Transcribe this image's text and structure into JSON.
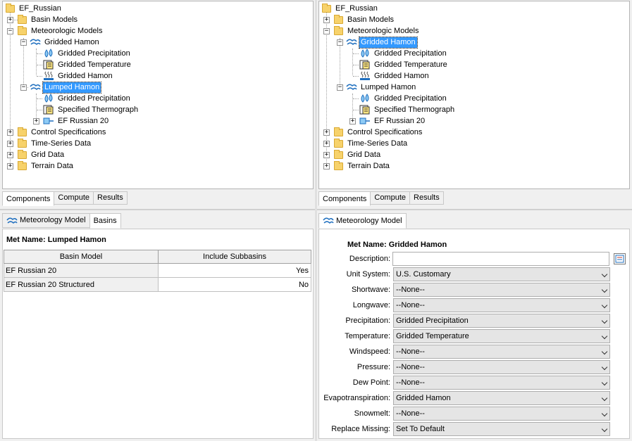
{
  "left_tree": {
    "root": "EF_Russian",
    "basin_models": "Basin Models",
    "met_models": "Meteorologic Models",
    "gridded_hamon": "Gridded Hamon",
    "gh_precip": "Gridded Precipitation",
    "gh_temp": "Gridded Temperature",
    "gh_et": "Gridded Hamon",
    "lumped_hamon": "Lumped Hamon",
    "lh_precip": "Gridded Precipitation",
    "lh_thermo": "Specified Thermograph",
    "lh_basin": "EF Russian 20",
    "control": "Control Specifications",
    "timeseries": "Time-Series Data",
    "grid": "Grid Data",
    "terrain": "Terrain Data"
  },
  "right_tree": {
    "root": "EF_Russian",
    "basin_models": "Basin Models",
    "met_models": "Meteorologic Models",
    "gridded_hamon": "Gridded Hamon",
    "gh_precip": "Gridded Precipitation",
    "gh_temp": "Gridded Temperature",
    "gh_et": "Gridded Hamon",
    "lumped_hamon": "Lumped Hamon",
    "lh_precip": "Gridded Precipitation",
    "lh_thermo": "Specified Thermograph",
    "lh_basin": "EF Russian 20",
    "control": "Control Specifications",
    "timeseries": "Time-Series Data",
    "grid": "Grid Data",
    "terrain": "Terrain Data"
  },
  "bottom_tabs": {
    "components": "Components",
    "compute": "Compute",
    "results": "Results"
  },
  "left_editor": {
    "tab_met": "Meteorology Model",
    "tab_basins": "Basins",
    "met_name_label": "Met Name:",
    "met_name_value": "Lumped Hamon",
    "col_basin": "Basin Model",
    "col_include": "Include Subbasins",
    "rows": [
      {
        "basin": "EF Russian 20",
        "include": "Yes"
      },
      {
        "basin": "EF Russian 20 Structured",
        "include": "No"
      }
    ]
  },
  "right_editor": {
    "tab_met": "Meteorology Model",
    "met_name_label": "Met Name:",
    "met_name_value": "Gridded Hamon",
    "description_label": "Description:",
    "description_value": "",
    "fields": [
      {
        "label": "Unit System:",
        "value": "U.S. Customary"
      },
      {
        "label": "Shortwave:",
        "value": "--None--"
      },
      {
        "label": "Longwave:",
        "value": "--None--"
      },
      {
        "label": "Precipitation:",
        "value": "Gridded Precipitation"
      },
      {
        "label": "Temperature:",
        "value": "Gridded Temperature"
      },
      {
        "label": "Windspeed:",
        "value": "--None--"
      },
      {
        "label": "Pressure:",
        "value": "--None--"
      },
      {
        "label": "Dew Point:",
        "value": "--None--"
      },
      {
        "label": "Evapotranspiration:",
        "value": "Gridded Hamon"
      },
      {
        "label": "Snowmelt:",
        "value": "--None--"
      },
      {
        "label": "Replace Missing:",
        "value": "Set To Default"
      }
    ]
  },
  "colors": {
    "selection": "#3399ff",
    "folder": "#f7d26b",
    "icon_blue": "#1f6fbf"
  }
}
